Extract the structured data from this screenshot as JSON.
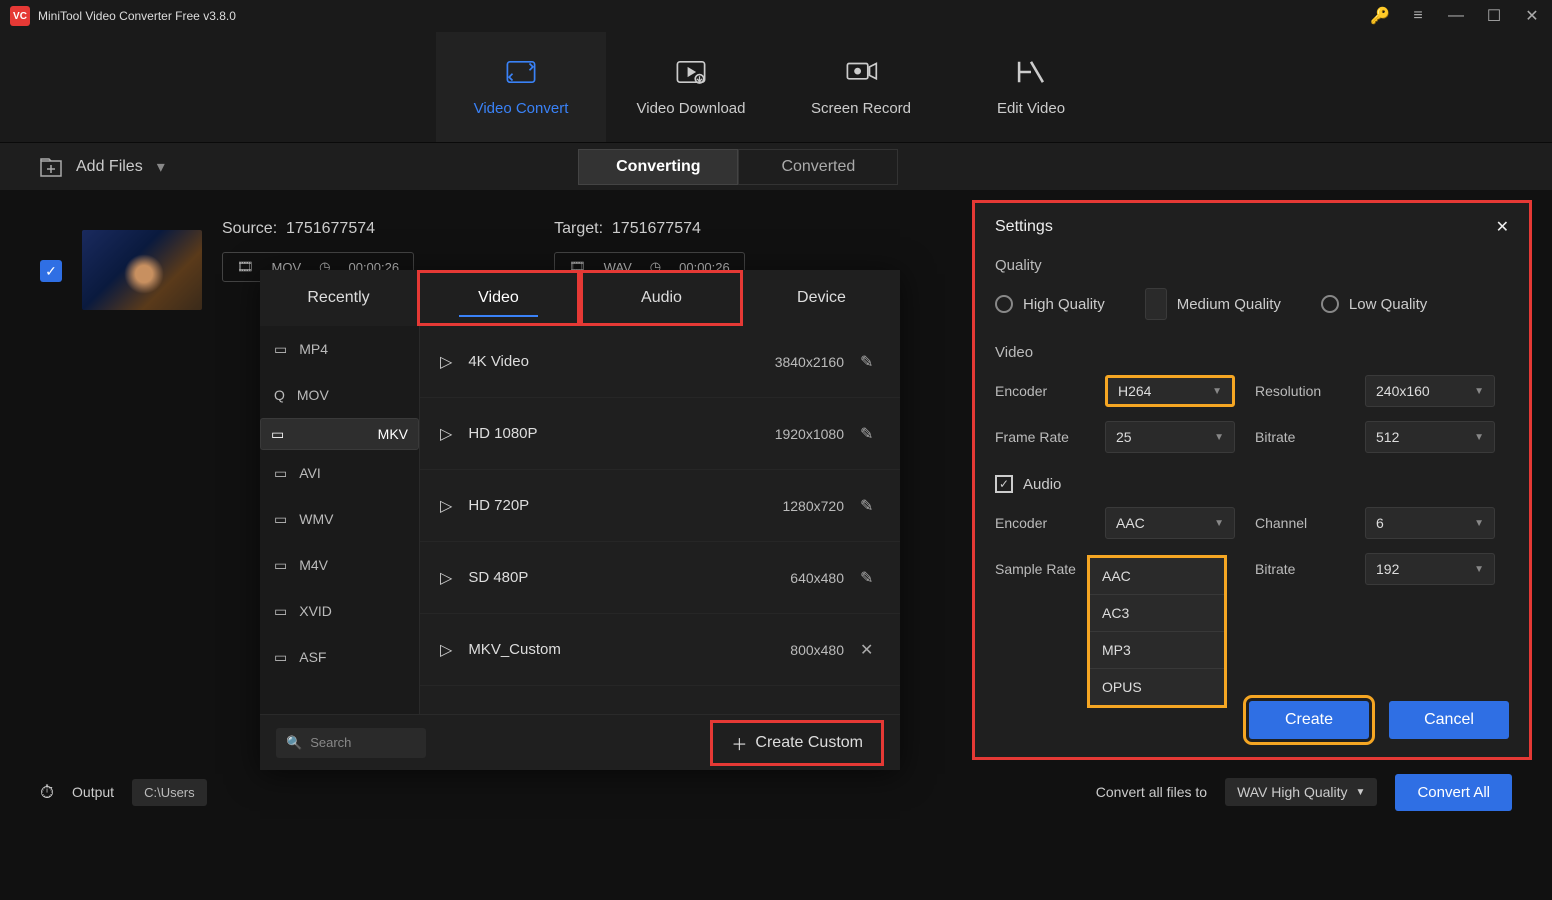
{
  "app": {
    "title": "MiniTool Video Converter Free v3.8.0"
  },
  "top_tabs": {
    "video_convert": "Video Convert",
    "video_download": "Video Download",
    "screen_record": "Screen Record",
    "edit_video": "Edit Video"
  },
  "sub_bar": {
    "add_files": "Add Files",
    "converting": "Converting",
    "converted": "Converted"
  },
  "file": {
    "source_label": "Source:",
    "source_name": "1751677574",
    "source_fmt": "MOV",
    "source_dur": "00:00:26",
    "target_label": "Target:",
    "target_name": "1751677574",
    "target_fmt": "WAV",
    "target_dur": "00:00:26"
  },
  "fmt": {
    "tabs": {
      "recently": "Recently",
      "video": "Video",
      "audio": "Audio",
      "device": "Device"
    },
    "left": [
      "MP4",
      "MOV",
      "MKV",
      "AVI",
      "WMV",
      "M4V",
      "XVID",
      "ASF"
    ],
    "left_selected": "MKV",
    "presets": [
      {
        "name": "4K Video",
        "res": "3840x2160",
        "icon": "edit"
      },
      {
        "name": "HD 1080P",
        "res": "1920x1080",
        "icon": "edit"
      },
      {
        "name": "HD 720P",
        "res": "1280x720",
        "icon": "edit"
      },
      {
        "name": "SD 480P",
        "res": "640x480",
        "icon": "edit"
      },
      {
        "name": "MKV_Custom",
        "res": "800x480",
        "icon": "close"
      }
    ],
    "search_placeholder": "Search",
    "create_custom": "Create Custom"
  },
  "settings": {
    "title": "Settings",
    "quality_label": "Quality",
    "quality": {
      "high": "High Quality",
      "medium": "Medium Quality",
      "low": "Low Quality",
      "selected": "medium"
    },
    "video_label": "Video",
    "video": {
      "encoder_label": "Encoder",
      "encoder": "H264",
      "resolution_label": "Resolution",
      "resolution": "240x160",
      "framerate_label": "Frame Rate",
      "framerate": "25",
      "bitrate_label": "Bitrate",
      "bitrate": "512"
    },
    "audio_label": "Audio",
    "audio": {
      "encoder_label": "Encoder",
      "encoder": "AAC",
      "channel_label": "Channel",
      "channel": "6",
      "samplerate_label": "Sample Rate",
      "bitrate_label": "Bitrate",
      "bitrate": "192",
      "encoder_options": [
        "AAC",
        "AC3",
        "MP3",
        "OPUS"
      ]
    },
    "create": "Create",
    "cancel": "Cancel"
  },
  "bottom": {
    "output_label": "Output",
    "output_path": "C:\\Users",
    "convert_all_to": "Convert all files to",
    "convert_all_sel": "WAV High Quality",
    "convert_all": "Convert All"
  }
}
